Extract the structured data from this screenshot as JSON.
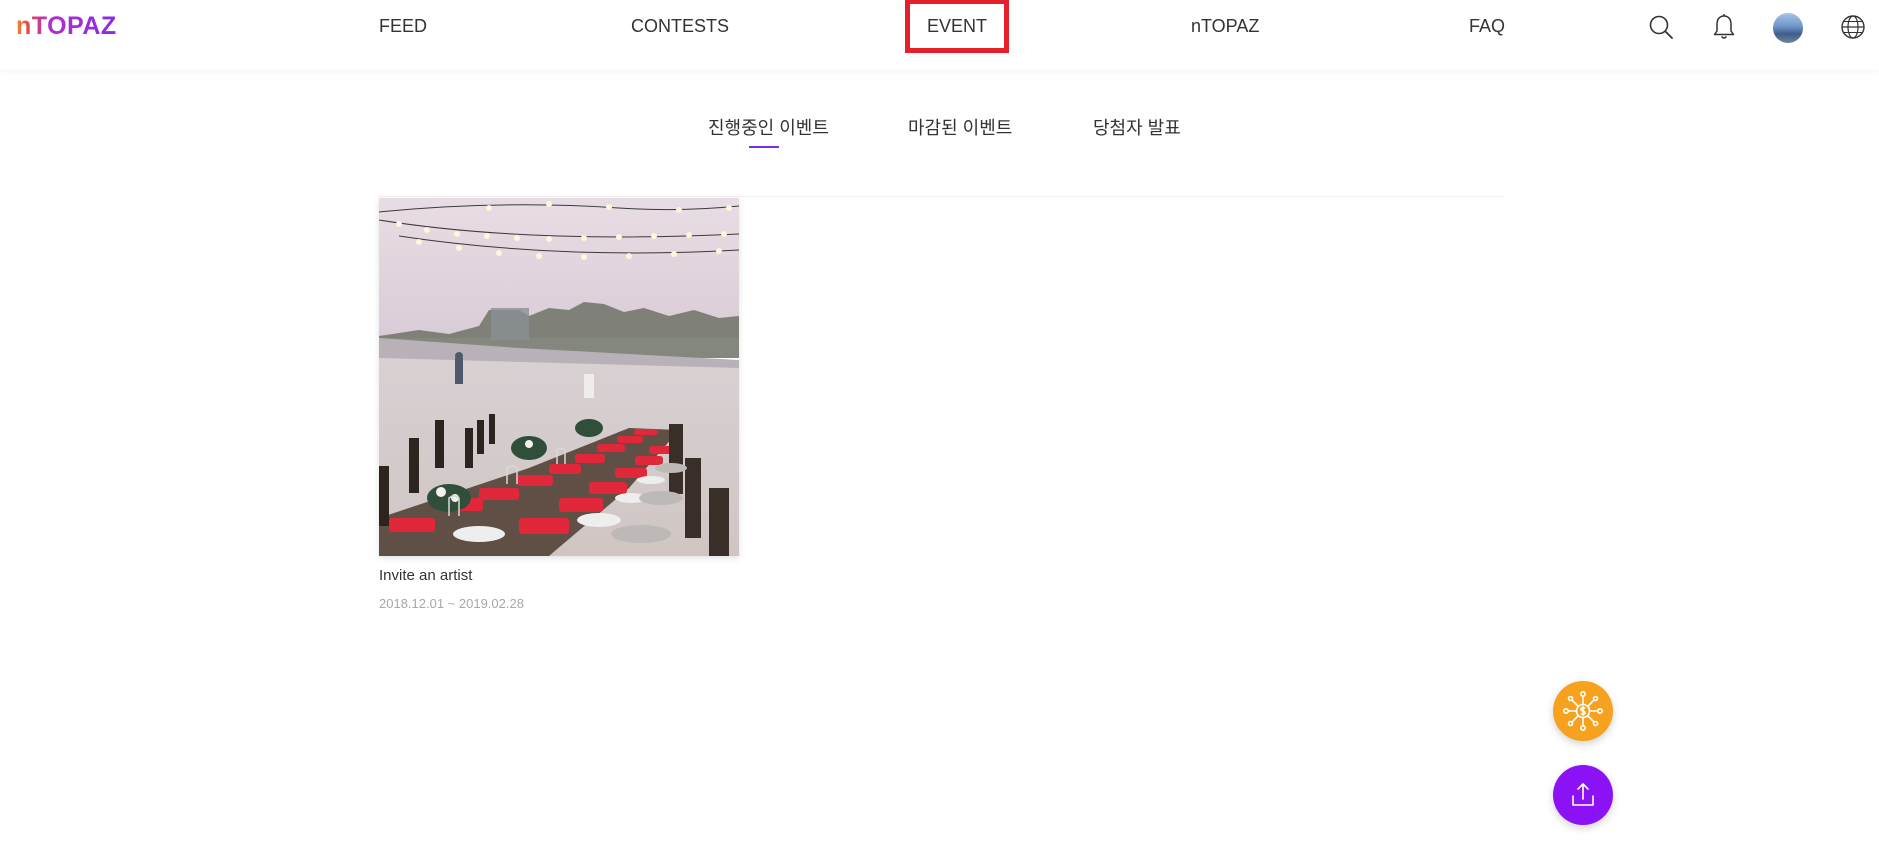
{
  "brand": {
    "logo_text": "nTOPAZ",
    "accent_color": "#8a2be2"
  },
  "nav": {
    "items": [
      {
        "label": "FEED"
      },
      {
        "label": "CONTESTS"
      },
      {
        "label": "EVENT"
      },
      {
        "label": "nTOPAZ"
      },
      {
        "label": "FAQ"
      }
    ],
    "active": "EVENT",
    "icons": [
      "search-icon",
      "bell-icon",
      "avatar",
      "globe-icon"
    ]
  },
  "subtabs": {
    "items": [
      {
        "label": "진행중인 이벤트"
      },
      {
        "label": "마감된 이벤트"
      },
      {
        "label": "당첨자 발표"
      }
    ],
    "active": "진행중인 이벤트"
  },
  "events": [
    {
      "title": "Invite an artist",
      "date_range": "2018.12.01 ~ 2019.02.28"
    }
  ],
  "floating_buttons": [
    {
      "icon": "network-coin-icon",
      "color": "#f6a21e"
    },
    {
      "icon": "upload-icon",
      "color": "#8a12f5"
    }
  ]
}
